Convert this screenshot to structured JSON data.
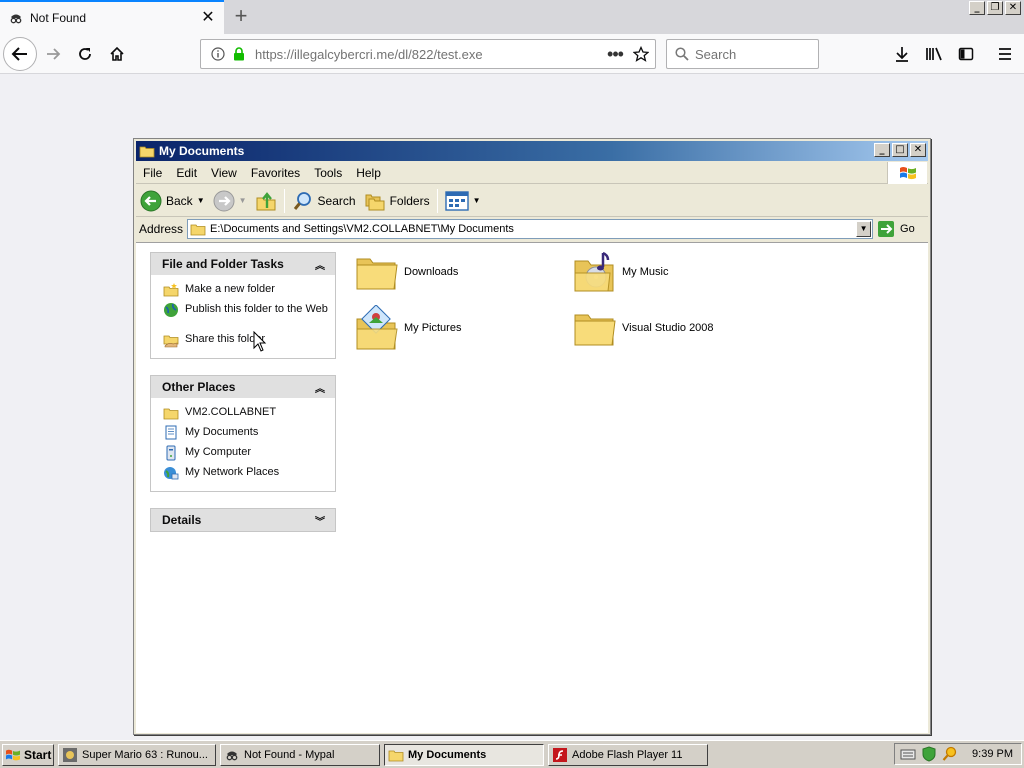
{
  "browser": {
    "tab_title": "Not Found",
    "tab_close": "✕",
    "new_tab": "+",
    "url": "https://illegalcybercri.me/dl/822/test.exe",
    "url_more": "•••",
    "search_placeholder": "Search"
  },
  "explorer": {
    "title": "My Documents",
    "menu": [
      "File",
      "Edit",
      "View",
      "Favorites",
      "Tools",
      "Help"
    ],
    "toolbar": {
      "back": "Back",
      "search": "Search",
      "folders": "Folders"
    },
    "address_label": "Address",
    "address_path": "E:\\Documents and Settings\\VM2.COLLABNET\\My Documents",
    "go_label": "Go",
    "task_panels": {
      "file_folder_tasks": {
        "title": "File and Folder Tasks",
        "items": [
          "Make a new folder",
          "Publish this folder to the Web",
          "Share this folder"
        ]
      },
      "other_places": {
        "title": "Other Places",
        "items": [
          "VM2.COLLABNET",
          "My Documents",
          "My Computer",
          "My Network Places"
        ]
      },
      "details": {
        "title": "Details"
      }
    },
    "files": [
      "Downloads",
      "My Music",
      "My Pictures",
      "Visual Studio 2008"
    ]
  },
  "taskbar": {
    "start": "Start",
    "tasks": [
      "Super Mario 63 : Runou...",
      "Not Found - Mypal",
      "My Documents",
      "Adobe Flash Player 11"
    ],
    "clock": "9:39 PM"
  },
  "colors": {
    "titlebar_start": "#0a246a",
    "titlebar_end": "#a6caf0",
    "tab_accent": "#0a84ff",
    "secure_lock": "#12bc00"
  }
}
